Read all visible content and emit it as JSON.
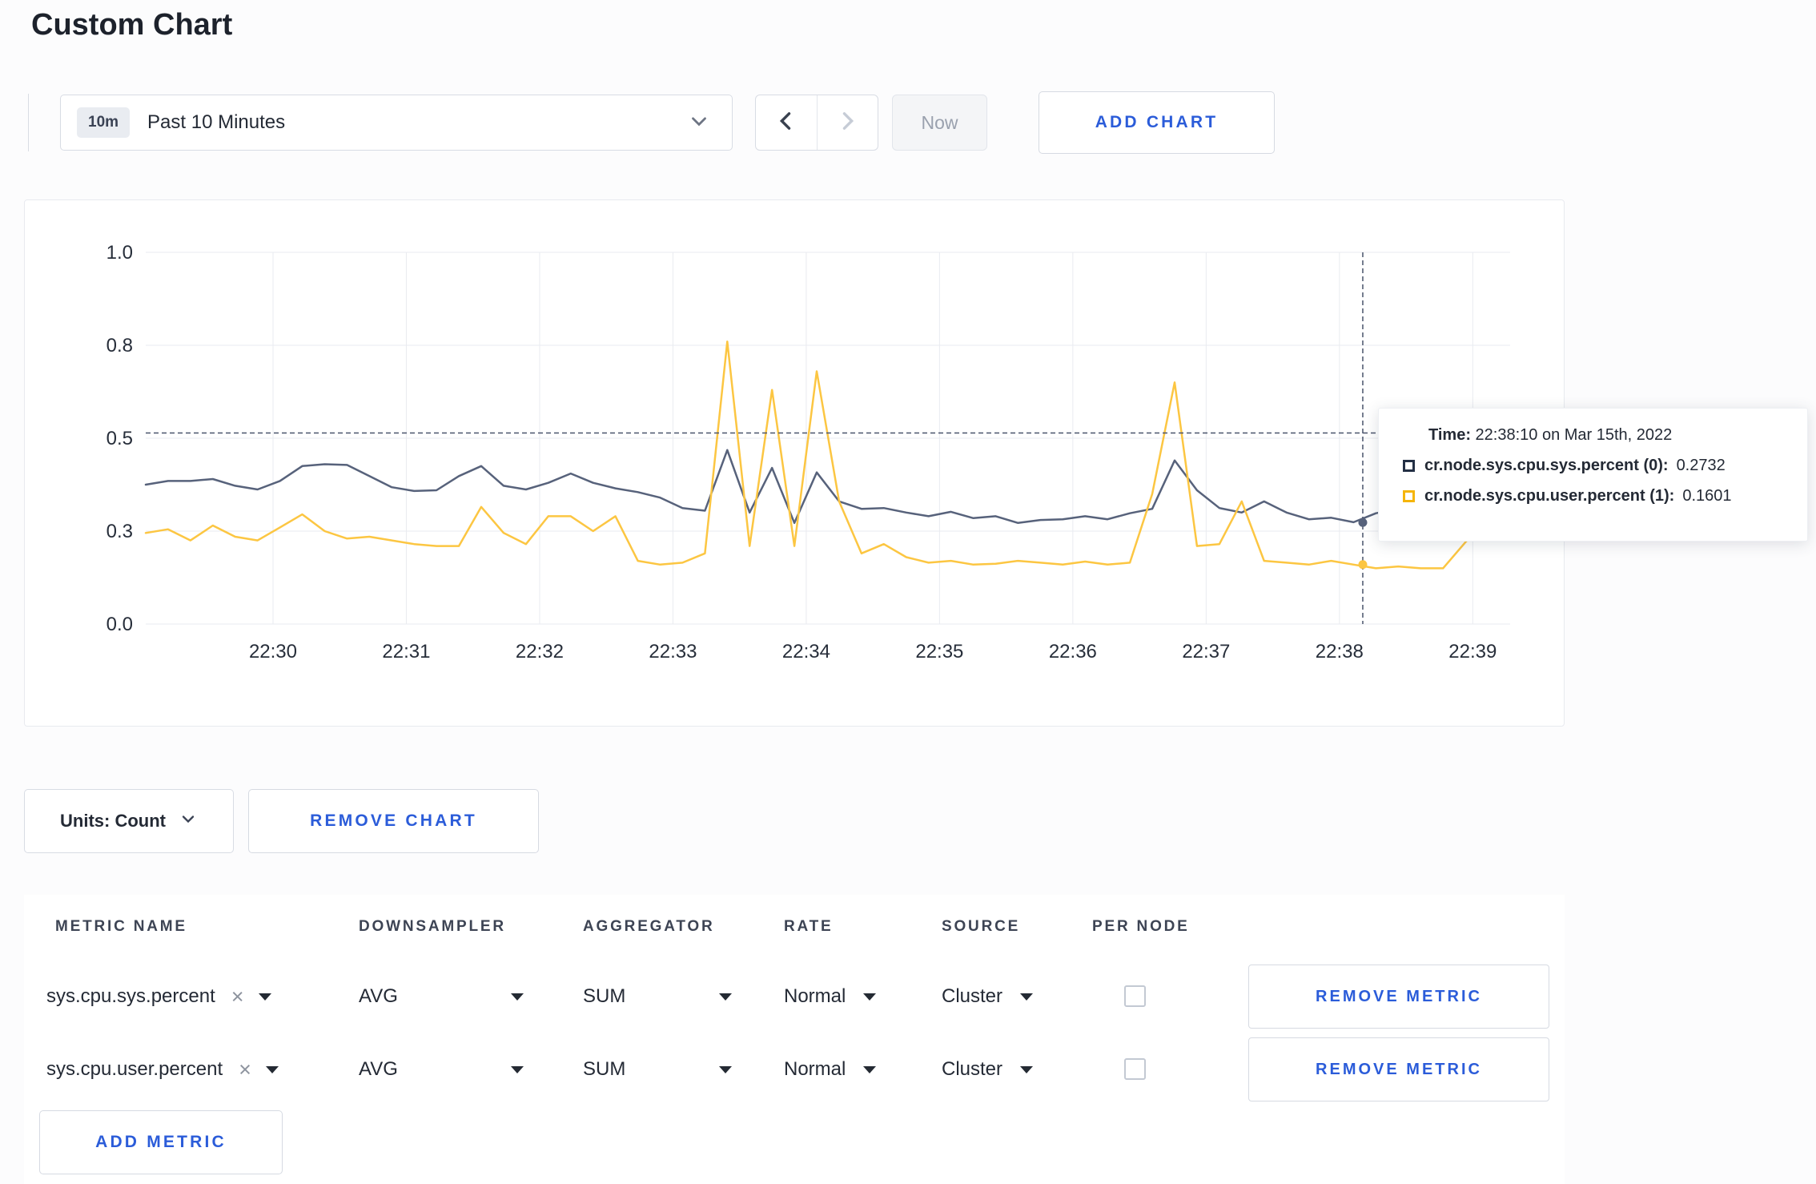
{
  "page": {
    "title": "Custom Chart"
  },
  "toolbar": {
    "range_badge": "10m",
    "range_label": "Past 10 Minutes",
    "now_label": "Now",
    "add_chart_label": "ADD CHART"
  },
  "chart_data": {
    "type": "line",
    "title": "Custom Chart",
    "ylabel": "",
    "ylim": [
      0,
      1
    ],
    "grid": true,
    "y_gridlines": [
      {
        "f": 1.0,
        "label": "1.0"
      },
      {
        "f": 0.75,
        "label": "0.8"
      },
      {
        "f": 0.5,
        "label": "0.5"
      },
      {
        "f": 0.25,
        "label": "0.3"
      },
      {
        "f": 0.0,
        "label": "0.0"
      }
    ],
    "x_ticks": [
      {
        "label": "22:30",
        "f": 0.0933
      },
      {
        "label": "22:31",
        "f": 0.191
      },
      {
        "label": "22:32",
        "f": 0.2887
      },
      {
        "label": "22:33",
        "f": 0.3864
      },
      {
        "label": "22:34",
        "f": 0.4841
      },
      {
        "label": "22:35",
        "f": 0.5818
      },
      {
        "label": "22:36",
        "f": 0.6795
      },
      {
        "label": "22:37",
        "f": 0.7772
      },
      {
        "label": "22:38",
        "f": 0.8749
      },
      {
        "label": "22:39",
        "f": 0.9726
      }
    ],
    "x_step_seconds": 10,
    "series": [
      {
        "name": "cr.node.sys.cpu.sys.percent",
        "color": "#57627b",
        "values": [
          0.375,
          0.385,
          0.385,
          0.39,
          0.372,
          0.362,
          0.385,
          0.425,
          0.43,
          0.428,
          0.398,
          0.368,
          0.358,
          0.36,
          0.398,
          0.425,
          0.372,
          0.362,
          0.38,
          0.405,
          0.38,
          0.365,
          0.355,
          0.34,
          0.312,
          0.305,
          0.468,
          0.3,
          0.42,
          0.272,
          0.408,
          0.33,
          0.31,
          0.312,
          0.3,
          0.29,
          0.302,
          0.285,
          0.29,
          0.272,
          0.28,
          0.282,
          0.29,
          0.282,
          0.298,
          0.31,
          0.44,
          0.36,
          0.312,
          0.3,
          0.33,
          0.3,
          0.282,
          0.286,
          0.274,
          0.298,
          0.31,
          0.314,
          0.272,
          0.288,
          0.306,
          0.3
        ]
      },
      {
        "name": "cr.node.sys.cpu.user.percent",
        "color": "#fcc642",
        "values": [
          0.245,
          0.255,
          0.225,
          0.265,
          0.235,
          0.225,
          0.26,
          0.295,
          0.25,
          0.23,
          0.235,
          0.225,
          0.215,
          0.21,
          0.21,
          0.315,
          0.245,
          0.215,
          0.29,
          0.29,
          0.25,
          0.29,
          0.17,
          0.16,
          0.165,
          0.19,
          0.76,
          0.21,
          0.63,
          0.21,
          0.68,
          0.33,
          0.19,
          0.215,
          0.18,
          0.165,
          0.17,
          0.16,
          0.162,
          0.17,
          0.165,
          0.16,
          0.168,
          0.16,
          0.165,
          0.35,
          0.65,
          0.21,
          0.215,
          0.33,
          0.17,
          0.165,
          0.16,
          0.17,
          0.16,
          0.15,
          0.155,
          0.15,
          0.15,
          0.22,
          0.28,
          0.245
        ]
      }
    ],
    "hover": {
      "x_frac": 0.892,
      "y_frac": 0.514,
      "time": "22:38:10 on Mar 15th, 2022",
      "points": [
        0.2732,
        0.1601
      ]
    }
  },
  "tooltip": {
    "time_label": "Time:",
    "time_value": "22:38:10 on Mar 15th, 2022",
    "rows": [
      {
        "name": "cr.node.sys.cpu.sys.percent (0):",
        "value": "0.2732",
        "color": "#232f44"
      },
      {
        "name": "cr.node.sys.cpu.user.percent (1):",
        "value": "0.1601",
        "color": "#f5b50a"
      }
    ]
  },
  "controls": {
    "units_label": "Units: Count",
    "remove_chart_label": "REMOVE CHART",
    "add_metric_label": "ADD METRIC"
  },
  "table": {
    "headers": [
      "METRIC NAME",
      "DOWNSAMPLER",
      "AGGREGATOR",
      "RATE",
      "SOURCE",
      "PER NODE"
    ],
    "rows": [
      {
        "metric": "sys.cpu.sys.percent",
        "downsampler": "AVG",
        "aggregator": "SUM",
        "rate": "Normal",
        "source": "Cluster",
        "per_node_checked": false,
        "remove_label": "REMOVE METRIC"
      },
      {
        "metric": "sys.cpu.user.percent",
        "downsampler": "AVG",
        "aggregator": "SUM",
        "rate": "Normal",
        "source": "Cluster",
        "per_node_checked": false,
        "remove_label": "REMOVE METRIC"
      }
    ]
  }
}
